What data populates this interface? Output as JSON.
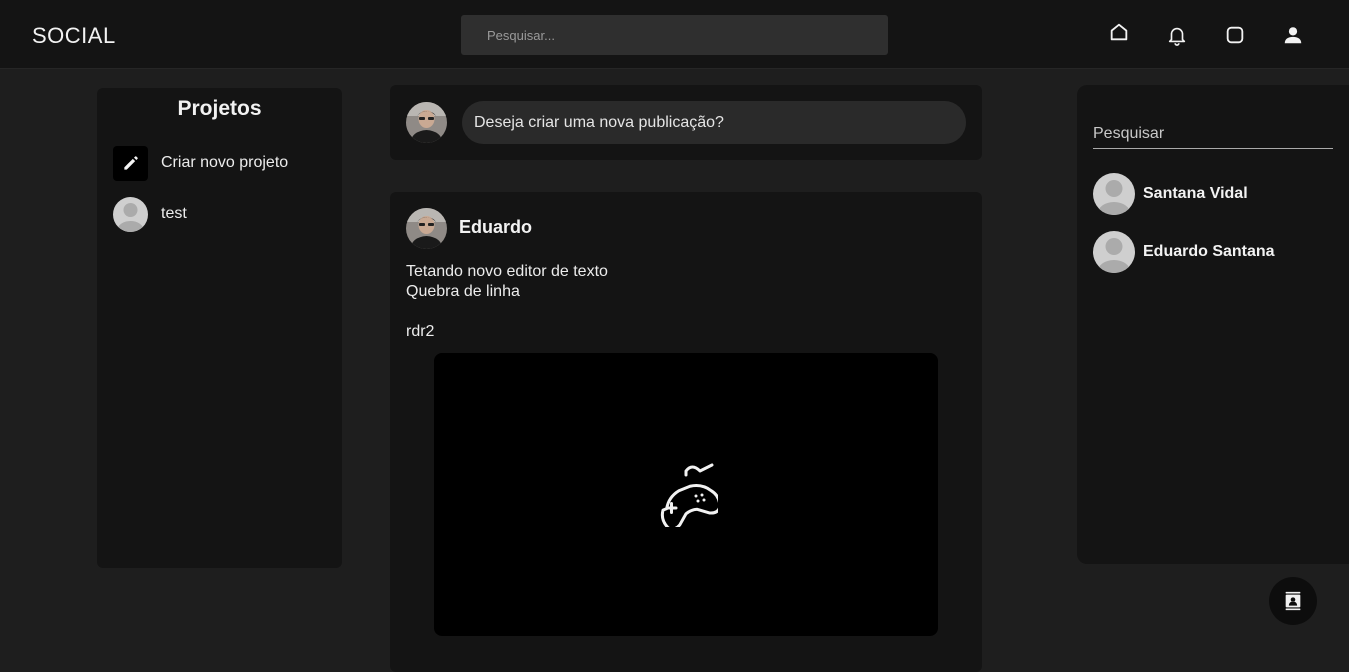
{
  "header": {
    "brand": "SOCIAL",
    "search_placeholder": "Pesquisar...",
    "icons": [
      "home-icon",
      "bell-icon",
      "messages-icon",
      "profile-icon"
    ]
  },
  "projects": {
    "title": "Projetos",
    "items": [
      {
        "label": "Criar novo projeto",
        "icon": "pencil-icon"
      },
      {
        "label": "test",
        "icon": "avatar"
      }
    ]
  },
  "compose": {
    "prompt": "Deseja criar uma nova publicação?"
  },
  "post": {
    "author": "Eduardo",
    "lines": [
      "Tetando novo editor de texto",
      "Quebra de linha",
      "",
      "rdr2"
    ],
    "media_icon": "gamepad-icon"
  },
  "sidebar_right": {
    "search_placeholder": "Pesquisar",
    "users": [
      {
        "name": "Santana Vidal"
      },
      {
        "name": "Eduardo Santana"
      }
    ]
  },
  "fab": {
    "icon": "contacts-icon"
  },
  "colors": {
    "background": "#1e1e1e",
    "panel": "#141414",
    "topbar": "#141414",
    "input": "#2f2f2f"
  }
}
